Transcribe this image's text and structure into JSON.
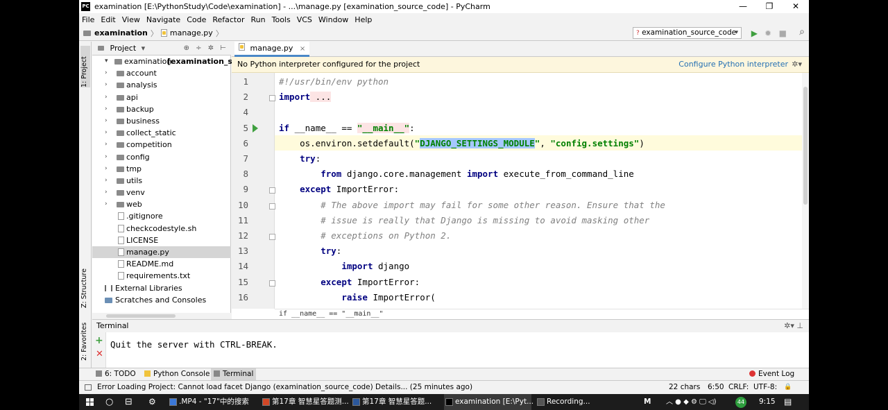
{
  "window": {
    "title": "examination [E:\\PythonStudy\\Code\\examination] - ...\\manage.py [examination_source_code] - PyCharm",
    "logo": "PC",
    "minimize": "—",
    "restore": "❐",
    "close": "✕"
  },
  "menu": [
    "File",
    "Edit",
    "View",
    "Navigate",
    "Code",
    "Refactor",
    "Run",
    "Tools",
    "VCS",
    "Window",
    "Help"
  ],
  "navbar": {
    "project": "examination",
    "file": "manage.py",
    "sep": "〉",
    "run_config": "examination_source_code",
    "run_icon": "▶",
    "debug_icon": "✹",
    "stop_icon": "■",
    "search_icon": "⌕"
  },
  "left_stripe": {
    "project": "1: Project",
    "structure": "Z: Structure",
    "favorites": "2: Favorites"
  },
  "project_panel": {
    "header": "Project",
    "dropdown": "▾",
    "tools": "⊕ ÷ ✲ ⊢",
    "tree": [
      {
        "label": "examination",
        "bold": "[examination_source_code]",
        "arrow": "▾",
        "type": "folder",
        "level": 0
      },
      {
        "label": "account",
        "arrow": "›",
        "type": "folder",
        "level": 1
      },
      {
        "label": "analysis",
        "arrow": "›",
        "type": "folder",
        "level": 1
      },
      {
        "label": "api",
        "arrow": "›",
        "type": "folder",
        "level": 1
      },
      {
        "label": "backup",
        "arrow": "›",
        "type": "folder",
        "level": 1
      },
      {
        "label": "business",
        "arrow": "›",
        "type": "folder",
        "level": 1
      },
      {
        "label": "collect_static",
        "arrow": "›",
        "type": "folder",
        "level": 1
      },
      {
        "label": "competition",
        "arrow": "›",
        "type": "folder",
        "level": 1
      },
      {
        "label": "config",
        "arrow": "›",
        "type": "folder",
        "level": 1
      },
      {
        "label": "tmp",
        "arrow": "›",
        "type": "folder",
        "level": 1
      },
      {
        "label": "utils",
        "arrow": "›",
        "type": "folder",
        "level": 1
      },
      {
        "label": "venv",
        "arrow": "›",
        "type": "folder",
        "level": 1
      },
      {
        "label": "web",
        "arrow": "›",
        "type": "folder",
        "level": 1
      },
      {
        "label": ".gitignore",
        "type": "file",
        "level": 2
      },
      {
        "label": "checkcodestyle.sh",
        "type": "file",
        "level": 2
      },
      {
        "label": "LICENSE",
        "type": "file",
        "level": 2
      },
      {
        "label": "manage.py",
        "type": "file",
        "level": 2,
        "selected": true
      },
      {
        "label": "README.md",
        "type": "file",
        "level": 2
      },
      {
        "label": "requirements.txt",
        "type": "file",
        "level": 2
      },
      {
        "label": "External Libraries",
        "type": "lib",
        "level": 0
      },
      {
        "label": "Scratches and Consoles",
        "type": "scratch",
        "level": 0
      }
    ]
  },
  "editor": {
    "tab": "manage.py",
    "tab_close": "×",
    "banner": "No Python interpreter configured for the project",
    "banner_link": "Configure Python interpreter",
    "banner_gear": "✲▾",
    "ok_mark": "✔",
    "breadcrumb": "if __name__ == \"__main__\"",
    "lines": [
      {
        "n": "1",
        "segs": [
          {
            "t": "#!/usr/bin/env python",
            "c": "cm"
          }
        ]
      },
      {
        "n": "2",
        "segs": [
          {
            "t": "import",
            "c": "kw"
          },
          {
            "t": " ...",
            "c": "sth"
          }
        ]
      },
      {
        "n": "4",
        "segs": []
      },
      {
        "n": "5",
        "segs": [
          {
            "t": "if",
            "c": "kw"
          },
          {
            "t": " __name__ == ",
            "c": ""
          },
          {
            "t": "\"__main__\"",
            "c": "st sth"
          },
          {
            "t": ":",
            "c": ""
          }
        ]
      },
      {
        "n": "6",
        "segs": [
          {
            "t": "    os.environ.setdefault(",
            "c": ""
          },
          {
            "t": "\"",
            "c": "st"
          },
          {
            "t": "DJANGO_SETTINGS_MODULE",
            "c": "st sel-txt"
          },
          {
            "t": "\"",
            "c": "st"
          },
          {
            "t": ", ",
            "c": ""
          },
          {
            "t": "\"config.settings\"",
            "c": "st"
          },
          {
            "t": ")",
            "c": ""
          }
        ]
      },
      {
        "n": "7",
        "segs": [
          {
            "t": "    ",
            "c": ""
          },
          {
            "t": "try",
            "c": "kw"
          },
          {
            "t": ":",
            "c": ""
          }
        ]
      },
      {
        "n": "8",
        "segs": [
          {
            "t": "        ",
            "c": ""
          },
          {
            "t": "from",
            "c": "kw"
          },
          {
            "t": " django.core.management ",
            "c": ""
          },
          {
            "t": "import",
            "c": "kw"
          },
          {
            "t": " execute_from_command_line",
            "c": ""
          }
        ]
      },
      {
        "n": "9",
        "segs": [
          {
            "t": "    ",
            "c": ""
          },
          {
            "t": "except",
            "c": "kw"
          },
          {
            "t": " ImportError:",
            "c": ""
          }
        ]
      },
      {
        "n": "10",
        "segs": [
          {
            "t": "        # The above import may fail for some other reason. Ensure that the",
            "c": "cm"
          }
        ]
      },
      {
        "n": "11",
        "segs": [
          {
            "t": "        # issue is really that Django is missing to avoid masking other",
            "c": "cm"
          }
        ]
      },
      {
        "n": "12",
        "segs": [
          {
            "t": "        # exceptions on Python 2.",
            "c": "cm"
          }
        ]
      },
      {
        "n": "13",
        "segs": [
          {
            "t": "        ",
            "c": ""
          },
          {
            "t": "try",
            "c": "kw"
          },
          {
            "t": ":",
            "c": ""
          }
        ]
      },
      {
        "n": "14",
        "segs": [
          {
            "t": "            ",
            "c": ""
          },
          {
            "t": "import",
            "c": "kw"
          },
          {
            "t": " django",
            "c": ""
          }
        ]
      },
      {
        "n": "15",
        "segs": [
          {
            "t": "        ",
            "c": ""
          },
          {
            "t": "except",
            "c": "kw"
          },
          {
            "t": " ImportError:",
            "c": ""
          }
        ]
      },
      {
        "n": "16",
        "segs": [
          {
            "t": "            ",
            "c": ""
          },
          {
            "t": "raise",
            "c": "kw"
          },
          {
            "t": " ImportError(",
            "c": ""
          }
        ]
      }
    ]
  },
  "terminal": {
    "header": "Terminal",
    "tools": "✲▾ ⊥",
    "plus": "+",
    "close": "✕",
    "output": "Quit the server with CTRL-BREAK."
  },
  "bottom_tabs": {
    "todo": "6: TODO",
    "python_console": "Python Console",
    "terminal": "Terminal",
    "event_log": "Event Log"
  },
  "status": {
    "message": "Error Loading Project: Cannot load facet Django (examination_source_code) Details... (25 minutes ago)",
    "chars": "22 chars",
    "position": "6:50",
    "line_sep": "CRLF:",
    "encoding": "UTF-8:"
  },
  "taskbar": {
    "search": "○",
    "task_view": "⊟",
    "items": [
      {
        "label": ".MP4 - \"17\"中的搜索",
        "color": "#3b78d8"
      },
      {
        "label": "第17章 智慧星答题测...",
        "color": "#d24726"
      },
      {
        "label": "第17章 智慧星答题...",
        "color": "#2b579a"
      },
      {
        "label": "examination [E:\\Pyt...",
        "color": "#000000",
        "active": true
      },
      {
        "label": "Recording...",
        "color": "#555555"
      }
    ],
    "tray_m": "M",
    "tray_icons": "︿ ● ◆ ⚙ 🖵 ◁)",
    "badge": "44",
    "time": "9:15",
    "notif": "▤"
  }
}
